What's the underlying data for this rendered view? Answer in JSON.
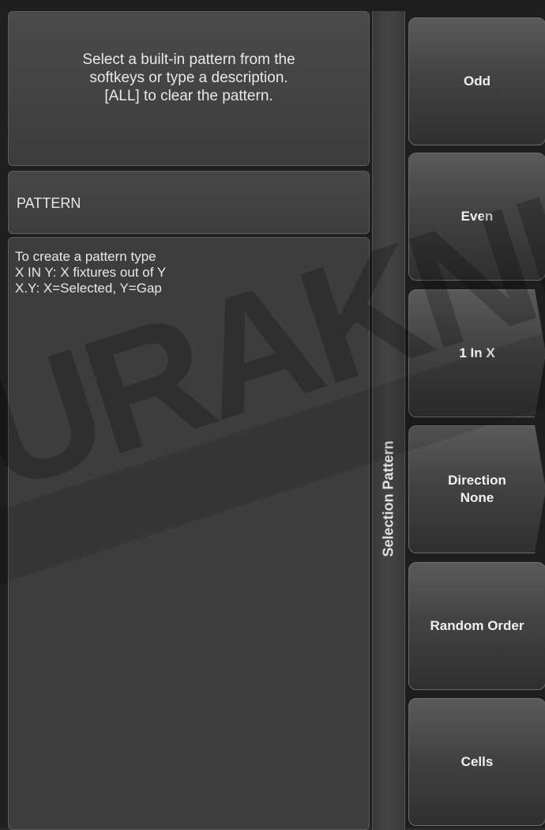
{
  "prompt": {
    "text": "Select a built-in pattern from the\nsoftkeys or type a description.\n[ALL] to clear the pattern."
  },
  "pattern_field": {
    "label": "PATTERN"
  },
  "help": {
    "lines": [
      "To create a pattern type",
      "X IN Y: X fixtures out of Y",
      "X.Y: X=Selected, Y=Gap"
    ]
  },
  "side_strip": {
    "label": "Selection Pattern"
  },
  "softkeys": [
    {
      "label": "Odd"
    },
    {
      "label": "Even"
    },
    {
      "label": "1 In X"
    },
    {
      "label": "Direction\nNone"
    },
    {
      "label": "Random Order"
    },
    {
      "label": "Cells"
    }
  ],
  "watermark": {
    "text": "URAKNIT"
  }
}
